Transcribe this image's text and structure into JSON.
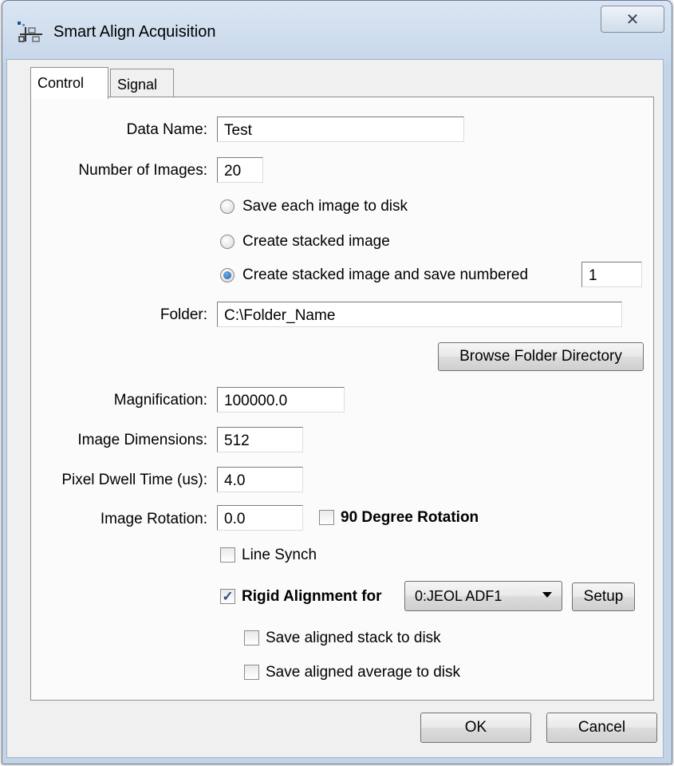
{
  "window": {
    "title": "Smart Align Acquisition",
    "close_glyph": "✕"
  },
  "tabs": [
    {
      "label": "Control"
    },
    {
      "label": "Signal"
    }
  ],
  "form": {
    "data_name": {
      "label": "Data Name:",
      "value": "Test"
    },
    "num_images": {
      "label": "Number of Images:",
      "value": "20"
    },
    "radios": [
      {
        "label": "Save each image to disk",
        "checked": false
      },
      {
        "label": "Create stacked image",
        "checked": false
      },
      {
        "label": "Create stacked image and save numbered",
        "checked": true
      }
    ],
    "numbered_value": "1",
    "folder": {
      "label": "Folder:",
      "value": "C:\\Folder_Name"
    },
    "browse_label": "Browse Folder Directory",
    "magnification": {
      "label": "Magnification:",
      "value": "100000.0"
    },
    "image_dimensions": {
      "label": "Image Dimensions:",
      "value": "512"
    },
    "dwell_time": {
      "label": "Pixel Dwell Time (us):",
      "value": "4.0"
    },
    "image_rotation": {
      "label": "Image Rotation:",
      "value": "0.0"
    },
    "rotation90": {
      "label": "90 Degree Rotation",
      "checked": false
    },
    "line_synch": {
      "label": "Line Synch",
      "checked": false
    },
    "rigid_alignment": {
      "label": "Rigid Alignment for",
      "checked": true
    },
    "detector": {
      "value": "0:JEOL ADF1"
    },
    "setup_label": "Setup",
    "save_stack": {
      "label": "Save aligned stack to disk",
      "checked": false
    },
    "save_average": {
      "label": "Save aligned average to disk",
      "checked": false
    }
  },
  "footer": {
    "ok_label": "OK",
    "cancel_label": "Cancel"
  },
  "colors": {
    "titlebar": "#c7d7ea",
    "panel": "#fbfbfb",
    "dialog_bg": "#f0f0f0"
  }
}
